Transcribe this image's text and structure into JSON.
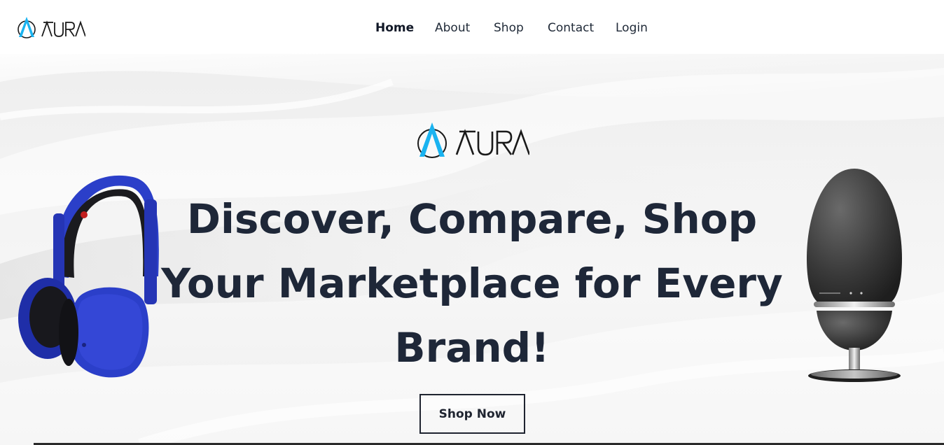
{
  "brand": {
    "name": "AURA",
    "accent_color": "#1ab3f0",
    "text_color": "#1a1a1a"
  },
  "nav": {
    "items": [
      {
        "label": "Home",
        "active": true
      },
      {
        "label": "About",
        "active": false
      },
      {
        "label": "Shop",
        "active": false
      },
      {
        "label": "Contact",
        "active": false
      },
      {
        "label": "Login",
        "active": false
      }
    ]
  },
  "hero": {
    "headline_lines": [
      "Discover, Compare, Shop",
      "Your Marketplace for Every",
      "Brand!"
    ],
    "cta_label": "Shop Now",
    "left_product_icon": "headphones-icon",
    "right_product_icon": "speaker-icon",
    "headline_color": "#1e2738",
    "headphone_color": "#2b3fc9"
  }
}
